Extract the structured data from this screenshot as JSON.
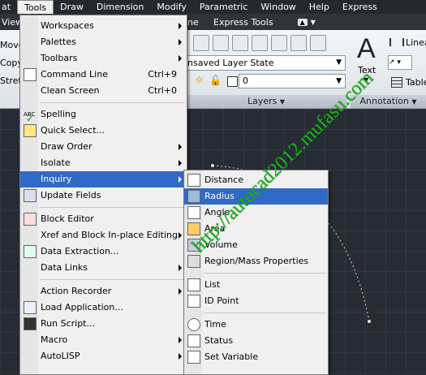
{
  "menubar": [
    "at",
    "Tools",
    "Draw",
    "Dimension",
    "Modify",
    "Parametric",
    "Window",
    "Help",
    "Express"
  ],
  "tabrow": {
    "left": "View",
    "partial": "ne",
    "express": "Express Tools"
  },
  "ribbon": {
    "left_items": [
      "Move",
      "Copy",
      "Stretc"
    ],
    "layer_state": "nsaved Layer State",
    "layer_current": "0",
    "panel_layers": "Layers",
    "panel_annotation": "Annotation",
    "text_label": "Text",
    "linear_label": "Linea",
    "table_label": "Table"
  },
  "tools_menu": [
    {
      "label": "Workspaces",
      "sub": true,
      "icon": "none"
    },
    {
      "label": "Palettes",
      "sub": true,
      "icon": "none"
    },
    {
      "label": "Toolbars",
      "sub": true,
      "icon": "none"
    },
    {
      "label": "Command Line",
      "shortcut": "Ctrl+9",
      "icon": "command-line-icon"
    },
    {
      "label": "Clean Screen",
      "shortcut": "Ctrl+0",
      "icon": "none"
    },
    {
      "sep": true
    },
    {
      "label": "Spelling",
      "icon": "spelling-icon"
    },
    {
      "label": "Quick Select...",
      "icon": "quick-select-icon"
    },
    {
      "label": "Draw Order",
      "sub": true,
      "icon": "none"
    },
    {
      "label": "Isolate",
      "sub": true,
      "icon": "none"
    },
    {
      "label": "Inquiry",
      "sub": true,
      "icon": "none",
      "hl": true
    },
    {
      "label": "Update Fields",
      "icon": "update-fields-icon"
    },
    {
      "sep": true
    },
    {
      "label": "Block Editor",
      "icon": "block-editor-icon"
    },
    {
      "label": "Xref and Block In-place Editing",
      "sub": true,
      "icon": "none"
    },
    {
      "label": "Data Extraction...",
      "icon": "data-extraction-icon"
    },
    {
      "label": "Data Links",
      "sub": true,
      "icon": "none"
    },
    {
      "sep": true
    },
    {
      "label": "Action Recorder",
      "sub": true,
      "icon": "none"
    },
    {
      "label": "Load Application...",
      "icon": "load-application-icon"
    },
    {
      "label": "Run Script...",
      "icon": "run-script-icon"
    },
    {
      "label": "Macro",
      "sub": true,
      "icon": "none"
    },
    {
      "label": "AutoLISP",
      "sub": true,
      "icon": "none"
    }
  ],
  "inquiry_menu": [
    {
      "label": "Distance",
      "icon": "distance-icon"
    },
    {
      "label": "Radius",
      "icon": "radius-icon",
      "hl": true
    },
    {
      "label": "Angle",
      "icon": "angle-icon"
    },
    {
      "label": "Area",
      "icon": "area-icon"
    },
    {
      "label": "Volume",
      "icon": "volume-icon"
    },
    {
      "label": "Region/Mass Properties",
      "icon": "region-mass-icon"
    },
    {
      "sep": true
    },
    {
      "label": "List",
      "icon": "list-icon"
    },
    {
      "label": "ID Point",
      "icon": "id-point-icon"
    },
    {
      "sep": true
    },
    {
      "label": "Time",
      "icon": "time-icon"
    },
    {
      "label": "Status",
      "icon": "status-icon"
    },
    {
      "label": "Set Variable",
      "icon": "set-variable-icon"
    }
  ],
  "watermark": "http://autocad2012.mufasu.com",
  "colors": {
    "highlight": "#3169c6",
    "watermark": "#1db31d"
  }
}
